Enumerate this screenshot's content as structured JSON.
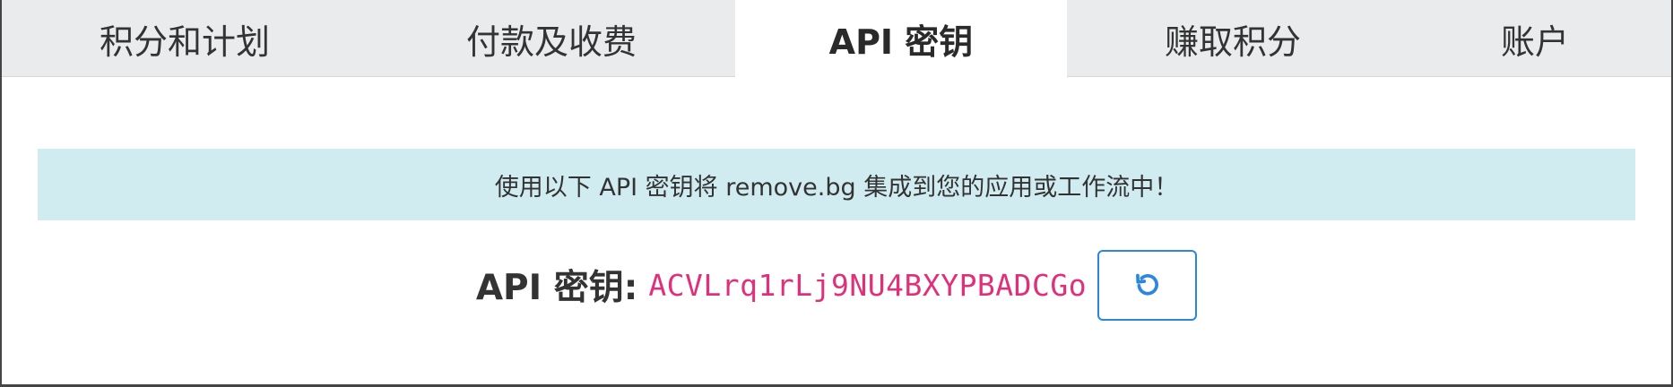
{
  "tabs": [
    {
      "label": "积分和计划"
    },
    {
      "label": "付款及收费"
    },
    {
      "label": "API 密钥"
    },
    {
      "label": "赚取积分"
    },
    {
      "label": "账户"
    }
  ],
  "active_tab": "API 密钥",
  "banner": {
    "text": "使用以下 API 密钥将 remove.bg 集成到您的应用或工作流中！"
  },
  "api_key": {
    "label": "API 密钥:",
    "value": "ACVLrq1rLj9NU4BXYPBADCGo",
    "regenerate_icon": "refresh-icon"
  },
  "colors": {
    "tab_bar": "#e9ebed",
    "banner_bg": "#d1ecf1",
    "key_text": "#e0307a",
    "button_accent": "#2b86e0"
  }
}
